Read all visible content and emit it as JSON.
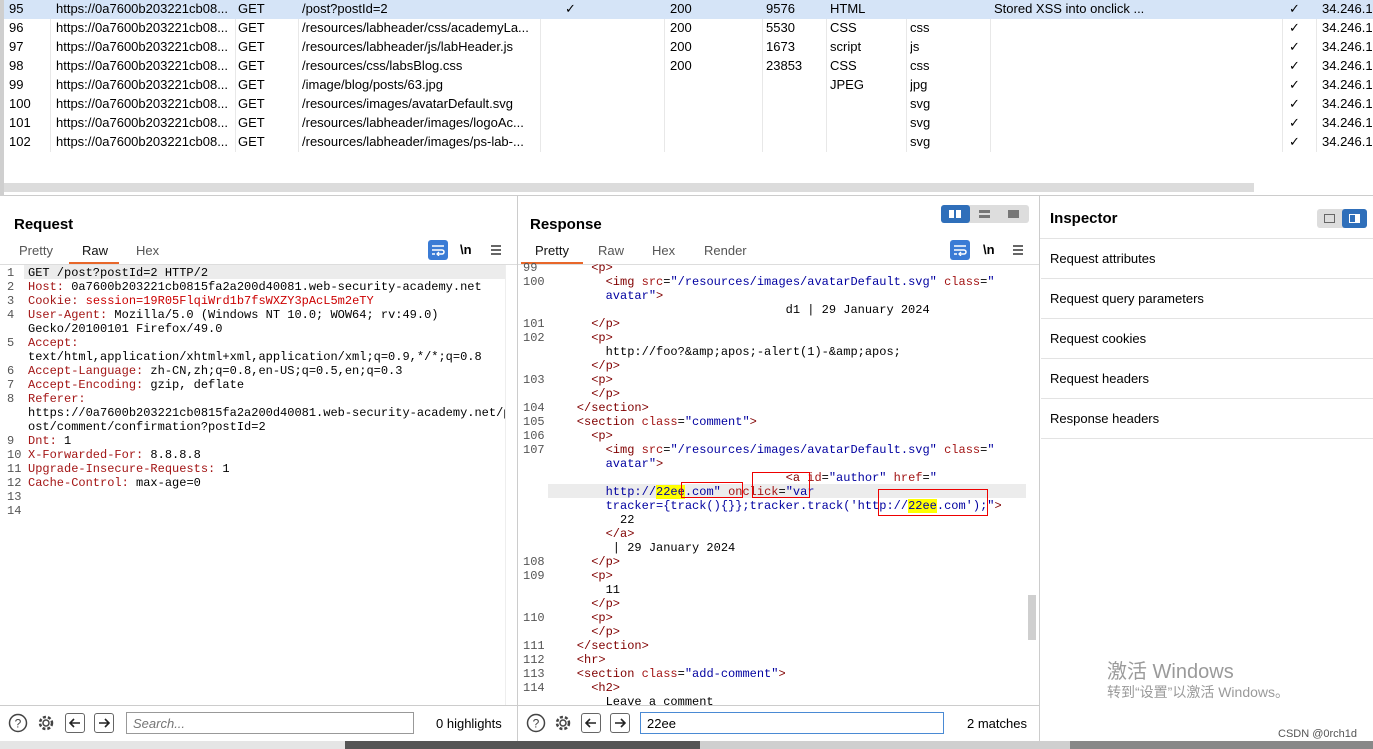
{
  "history": {
    "rows": [
      {
        "num": "95",
        "host": "https://0a7600b203221cb08...",
        "method": "GET",
        "url": "/post?postId=2",
        "params": "✓",
        "status": "200",
        "length": "9576",
        "mime": "HTML",
        "ext": "",
        "title": "Stored XSS into onclick ...",
        "tls": "✓",
        "ip": "34.246.12",
        "selected": true
      },
      {
        "num": "96",
        "host": "https://0a7600b203221cb08...",
        "method": "GET",
        "url": "/resources/labheader/css/academyLa...",
        "params": "",
        "status": "200",
        "length": "5530",
        "mime": "CSS",
        "ext": "css",
        "title": "",
        "tls": "✓",
        "ip": "34.246.12"
      },
      {
        "num": "97",
        "host": "https://0a7600b203221cb08...",
        "method": "GET",
        "url": "/resources/labheader/js/labHeader.js",
        "params": "",
        "status": "200",
        "length": "1673",
        "mime": "script",
        "ext": "js",
        "title": "",
        "tls": "✓",
        "ip": "34.246.12"
      },
      {
        "num": "98",
        "host": "https://0a7600b203221cb08...",
        "method": "GET",
        "url": "/resources/css/labsBlog.css",
        "params": "",
        "status": "200",
        "length": "23853",
        "mime": "CSS",
        "ext": "css",
        "title": "",
        "tls": "✓",
        "ip": "34.246.12"
      },
      {
        "num": "99",
        "host": "https://0a7600b203221cb08...",
        "method": "GET",
        "url": "/image/blog/posts/63.jpg",
        "params": "",
        "status": "",
        "length": "",
        "mime": "JPEG",
        "ext": "jpg",
        "title": "",
        "tls": "✓",
        "ip": "34.246.12"
      },
      {
        "num": "100",
        "host": "https://0a7600b203221cb08...",
        "method": "GET",
        "url": "/resources/images/avatarDefault.svg",
        "params": "",
        "status": "",
        "length": "",
        "mime": "",
        "ext": "svg",
        "title": "",
        "tls": "✓",
        "ip": "34.246.12"
      },
      {
        "num": "101",
        "host": "https://0a7600b203221cb08...",
        "method": "GET",
        "url": "/resources/labheader/images/logoAc...",
        "params": "",
        "status": "",
        "length": "",
        "mime": "",
        "ext": "svg",
        "title": "",
        "tls": "✓",
        "ip": "34.246.12"
      },
      {
        "num": "102",
        "host": "https://0a7600b203221cb08...",
        "method": "GET",
        "url": "/resources/labheader/images/ps-lab-...",
        "params": "",
        "status": "",
        "length": "",
        "mime": "",
        "ext": "svg",
        "title": "",
        "tls": "✓",
        "ip": "34.246.12"
      }
    ]
  },
  "request": {
    "title": "Request",
    "tabs": [
      "Pretty",
      "Raw",
      "Hex"
    ],
    "active_tab": "Raw",
    "newline_label": "\\n",
    "lines": [
      {
        "n": "1",
        "name": "",
        "value": "GET /post?postId=2 HTTP/2"
      },
      {
        "n": "2",
        "name": "Host:",
        "value": " 0a7600b203221cb0815fa2a200d40081.web-security-academy.net"
      },
      {
        "n": "3",
        "name": "Cookie:",
        "value": " session=19R05FlqiWrd1b7fsWXZY3pAcL5m2eTY"
      },
      {
        "n": "4",
        "name": "User-Agent:",
        "value": " Mozilla/5.0 (Windows NT 10.0; WOW64; rv:49.0)"
      },
      {
        "n": "",
        "name": "",
        "value": "Gecko/20100101 Firefox/49.0"
      },
      {
        "n": "5",
        "name": "Accept:",
        "value": ""
      },
      {
        "n": "",
        "name": "",
        "value": "text/html,application/xhtml+xml,application/xml;q=0.9,*/*;q=0.8"
      },
      {
        "n": "6",
        "name": "Accept-Language:",
        "value": " zh-CN,zh;q=0.8,en-US;q=0.5,en;q=0.3"
      },
      {
        "n": "7",
        "name": "Accept-Encoding:",
        "value": " gzip, deflate"
      },
      {
        "n": "8",
        "name": "Referer:",
        "value": ""
      },
      {
        "n": "",
        "name": "",
        "value": "https://0a7600b203221cb0815fa2a200d40081.web-security-academy.net/p"
      },
      {
        "n": "",
        "name": "",
        "value": "ost/comment/confirmation?postId=2"
      },
      {
        "n": "9",
        "name": "Dnt:",
        "value": " 1"
      },
      {
        "n": "10",
        "name": "X-Forwarded-For:",
        "value": " 8.8.8.8"
      },
      {
        "n": "11",
        "name": "Upgrade-Insecure-Requests:",
        "value": " 1"
      },
      {
        "n": "12",
        "name": "Cache-Control:",
        "value": " max-age=0"
      },
      {
        "n": "13",
        "name": "",
        "value": ""
      },
      {
        "n": "14",
        "name": "",
        "value": ""
      }
    ],
    "search_placeholder": "Search...",
    "highlights": "0 highlights"
  },
  "response": {
    "title": "Response",
    "tabs": [
      "Pretty",
      "Raw",
      "Hex",
      "Render"
    ],
    "active_tab": "Pretty",
    "newline_label": "\\n",
    "search_value": "22ee",
    "matches": "2 matches"
  },
  "inspector": {
    "title": "Inspector",
    "items": [
      "Request attributes",
      "Request query parameters",
      "Request cookies",
      "Request headers",
      "Response headers"
    ]
  },
  "watermark": {
    "line1": "激活 Windows",
    "line2": "转到“设置”以激活 Windows。"
  },
  "credit": "CSDN @0rch1d"
}
